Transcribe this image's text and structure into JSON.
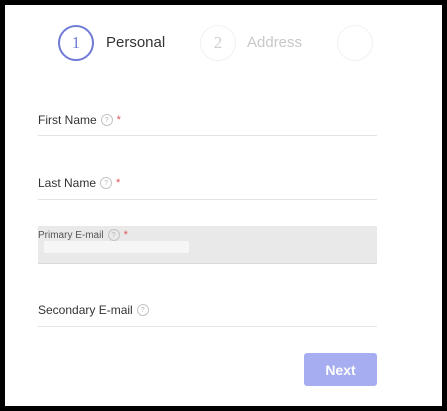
{
  "stepper": {
    "steps": [
      {
        "number": "1",
        "label": "Personal"
      },
      {
        "number": "2",
        "label": "Address"
      },
      {
        "number": "",
        "label": ""
      }
    ]
  },
  "form": {
    "first_name": {
      "label": "First Name",
      "required_mark": "*",
      "help_icon": "question-circle-icon"
    },
    "last_name": {
      "label": "Last Name",
      "required_mark": "*",
      "help_icon": "question-circle-icon"
    },
    "primary_email": {
      "label": "Primary E-mail",
      "required_mark": "*",
      "help_icon": "question-circle-icon"
    },
    "secondary_email": {
      "label": "Secondary E-mail",
      "help_icon": "question-circle-icon"
    }
  },
  "help_glyph": "?",
  "actions": {
    "next_label": "Next"
  },
  "colors": {
    "accent": "#6f7bd6",
    "button": "#a6adf0",
    "required": "#e25555"
  }
}
